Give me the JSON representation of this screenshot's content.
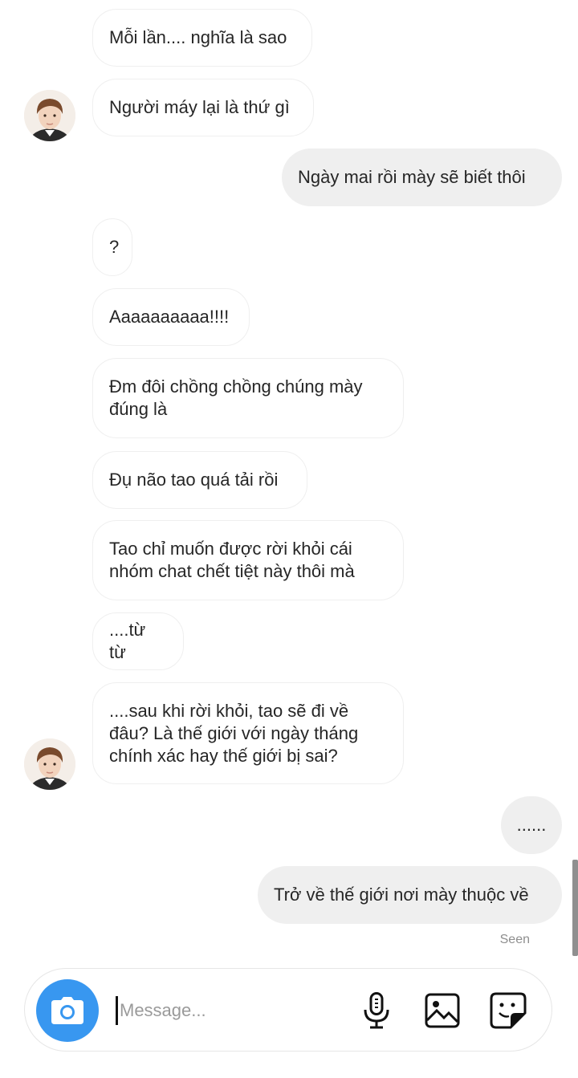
{
  "messages": [
    {
      "text": "Mỗi lần.... nghĩa là sao"
    },
    {
      "text": "Người máy lại là thứ gì"
    },
    {
      "text": "Ngày mai rồi mày sẽ biết thôi"
    },
    {
      "text": "?"
    },
    {
      "text": "Aaaaaaaaaa!!!!"
    },
    {
      "text": "Đm đôi chồng chồng chúng mày\nđúng là"
    },
    {
      "text": "Đụ não tao quá tải rồi"
    },
    {
      "text": "Tao chỉ muốn được rời khỏi cái\nnhóm chat chết tiệt này thôi mà"
    },
    {
      "text": "....từ từ"
    },
    {
      "text": "....sau khi rời khỏi, tao sẽ đi về\nđâu? Là thế giới với ngày tháng\nchính xác hay thế giới bị sai?"
    },
    {
      "text": "......"
    },
    {
      "text": "Trở về thế giới nơi mày thuộc về"
    }
  ],
  "status": {
    "seen": "Seen"
  },
  "composer": {
    "placeholder": "Message...",
    "icons": [
      "camera-icon",
      "microphone-icon",
      "gallery-icon",
      "sticker-icon"
    ]
  },
  "colors": {
    "accent": "#3897f0",
    "outgoing_bubble": "#efefef",
    "incoming_border": "#efefef"
  }
}
